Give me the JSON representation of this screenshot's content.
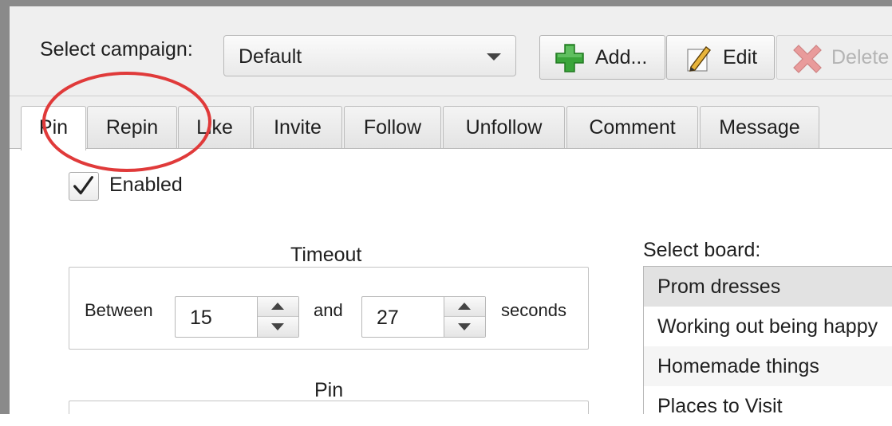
{
  "toolbar": {
    "campaign_label": "Select campaign:",
    "campaign_value": "Default",
    "add_label": "Add...",
    "edit_label": "Edit",
    "delete_label": "Delete"
  },
  "tabs": [
    {
      "label": "Pin",
      "active": true
    },
    {
      "label": "Repin"
    },
    {
      "label": "Like"
    },
    {
      "label": "Invite"
    },
    {
      "label": "Follow"
    },
    {
      "label": "Unfollow"
    },
    {
      "label": "Comment"
    },
    {
      "label": "Message"
    }
  ],
  "enabled": {
    "label": "Enabled",
    "checked": true
  },
  "timeout": {
    "title": "Timeout",
    "between_label": "Between",
    "from_value": "15",
    "and_label": "and",
    "to_value": "27",
    "seconds_label": "seconds"
  },
  "pin_group": {
    "title": "Pin"
  },
  "board": {
    "label": "Select board:",
    "items": [
      "Prom dresses",
      "Working out being happy",
      "Homemade things",
      "Places to Visit"
    ],
    "selected_index": 0
  },
  "colors": {
    "annotation_circle": "#e03a3a",
    "add_icon": "#3aa53a",
    "delete_icon": "#e05050"
  },
  "icons": {
    "add": "plus-icon",
    "edit": "pencil-icon",
    "delete": "x-icon",
    "enabled": "checkmark-icon"
  }
}
